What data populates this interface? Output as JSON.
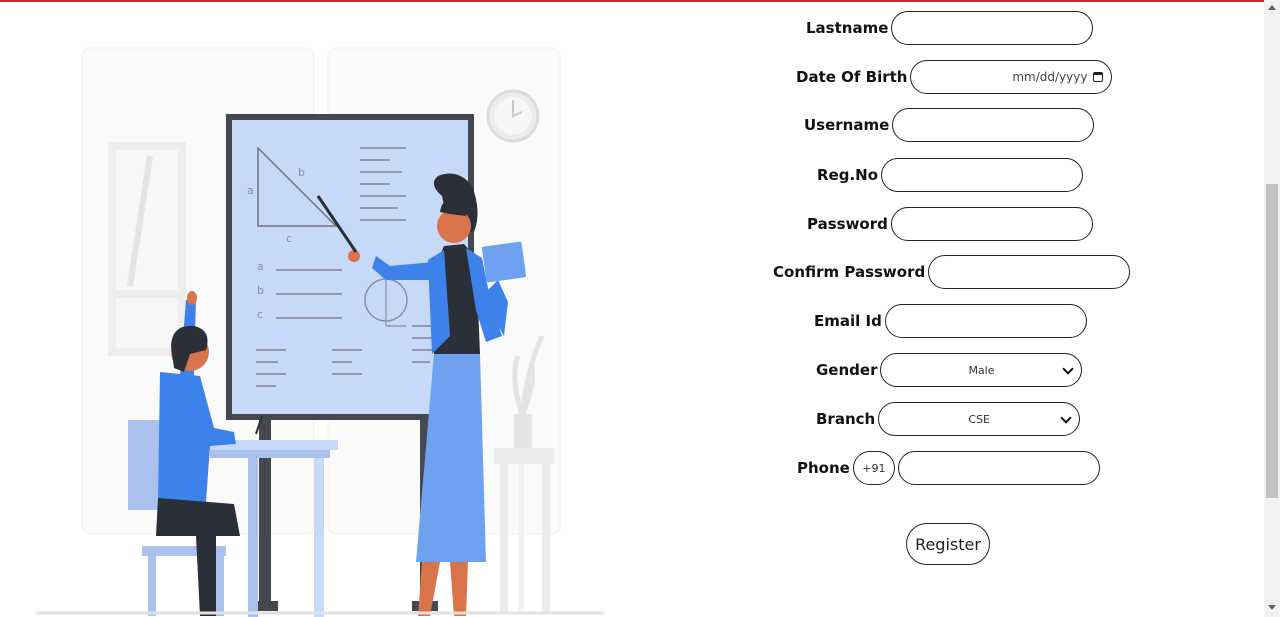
{
  "form": {
    "lastname_label": "Lastname",
    "dob_label": "Date Of Birth",
    "dob_placeholder": "mm/dd/yyyy",
    "username_label": "Username",
    "regno_label": "Reg.No",
    "password_label": "Password",
    "confirm_password_label": "Confirm Password",
    "email_label": "Email Id",
    "gender_label": "Gender",
    "gender_value": "Male",
    "branch_label": "Branch",
    "branch_value": "CSE",
    "phone_label": "Phone",
    "phone_code": "+91",
    "register_label": "Register"
  },
  "illustration": {
    "board_labels": [
      "a",
      "b",
      "c",
      "a",
      "b",
      "c"
    ]
  },
  "colors": {
    "accent": "#c62828",
    "figure_blue": "#3d82ea",
    "board_fill": "#c7d9f8"
  }
}
